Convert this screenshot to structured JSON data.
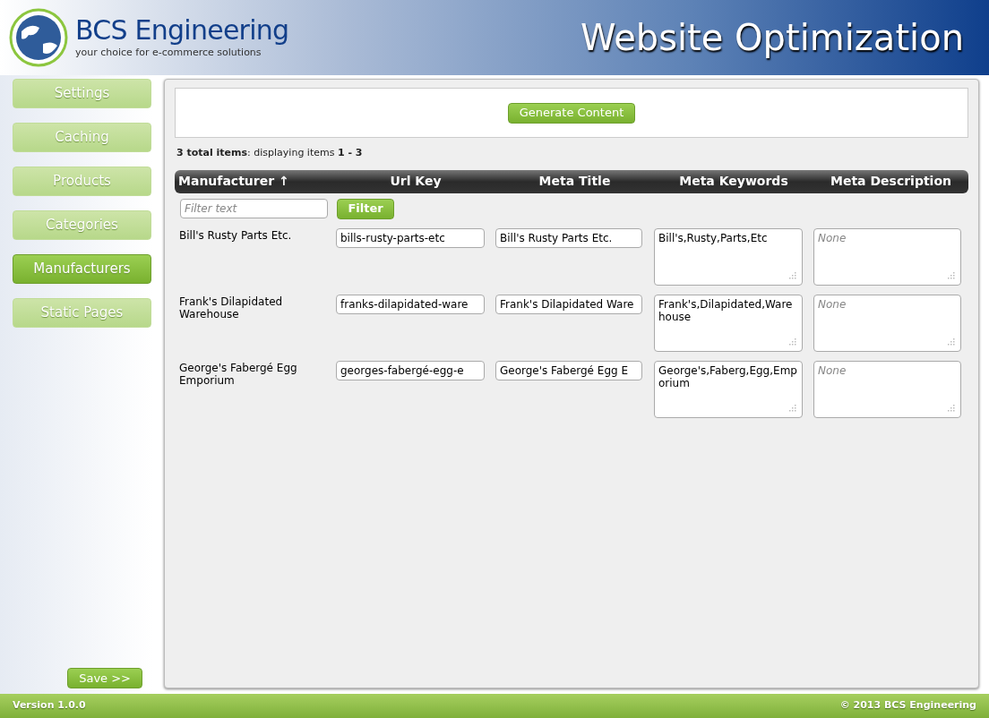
{
  "header": {
    "logo_name": "BCS Engineering",
    "tagline": "your choice for e-commerce solutions",
    "title": "Website Optimization"
  },
  "sidebar": {
    "items": [
      {
        "label": "Settings",
        "selected": false
      },
      {
        "label": "Caching",
        "selected": false
      },
      {
        "label": "Products",
        "selected": false
      },
      {
        "label": "Categories",
        "selected": false
      },
      {
        "label": "Manufacturers",
        "selected": true
      },
      {
        "label": "Static Pages",
        "selected": false
      }
    ],
    "save_button": "Save >>"
  },
  "toolbar": {
    "button": "Generate Content"
  },
  "summary": "**3 total items**: displaying items **1 - 3**",
  "table": {
    "columns": [
      "Manufacturer ↑",
      "Url Key",
      "Meta Title",
      "Meta Keywords",
      "Meta Description"
    ],
    "filter": {
      "placeholder": "Filter text",
      "button": "Filter"
    },
    "rows": [
      {
        "manufacturer": "Bill's Rusty Parts Etc.",
        "url_key": "bills-rusty-parts-etc",
        "meta_title": "Bill's Rusty Parts Etc.",
        "meta_keywords": "Bill's,Rusty,Parts,Etc",
        "meta_description_placeholder": "None"
      },
      {
        "manufacturer": "Frank's Dilapidated Warehouse",
        "url_key": "franks-dilapidated-ware",
        "meta_title": "Frank's Dilapidated Ware",
        "meta_keywords": "Frank's,Dilapidated,Warehouse",
        "meta_description_placeholder": "None"
      },
      {
        "manufacturer": "George's Fabergé Egg Emporium",
        "url_key": "georges-fabergé-egg-e",
        "meta_title": "George's Fabergé Egg E",
        "meta_keywords": "George's,Faberg,Egg,Emporium",
        "meta_description_placeholder": "None"
      }
    ]
  },
  "footer": {
    "version": "Version 1.0.0",
    "copyright": "© 2013 BCS Engineering"
  }
}
